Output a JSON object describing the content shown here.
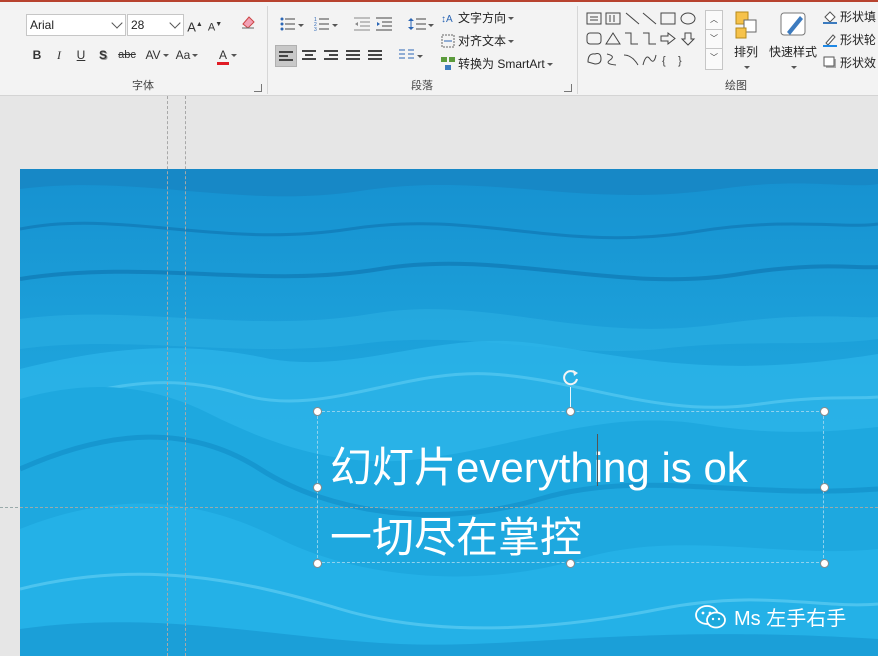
{
  "font_group": {
    "font_name": "Arial",
    "font_size": "28",
    "bold": "B",
    "italic": "I",
    "underline": "U",
    "shadow": "S",
    "strikethrough": "abc",
    "char_spacing": "AV",
    "change_case": "Aa",
    "font_color": "A",
    "label": "字体"
  },
  "paragraph_group": {
    "text_direction": "文字方向",
    "align_text": "对齐文本",
    "convert_smartart": "转换为 SmartArt",
    "label": "段落"
  },
  "drawing_group": {
    "arrange": "排列",
    "quick_styles": "快速样式",
    "shape_fill": "形状填",
    "shape_outline": "形状轮",
    "shape_effects": "形状效",
    "label": "绘图"
  },
  "slide": {
    "line1": "幻灯片everything is ok",
    "line2": "一切尽在掌控",
    "watermark": "Ms 左手右手"
  },
  "colors": {
    "accent": "#b8432f",
    "font_color_bar": "#e01b24",
    "slide_bg": "#1ea9dc"
  }
}
